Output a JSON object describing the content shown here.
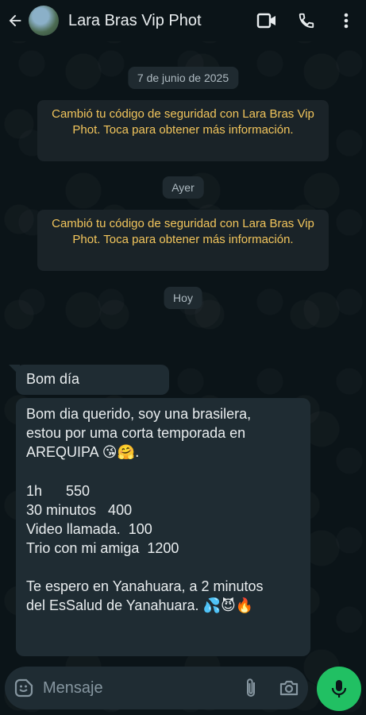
{
  "header": {
    "contact_name": "Lara Bras Vip Phot"
  },
  "chat": {
    "date_1": "7 de junio de 2025",
    "security_notice_1": "Cambió tu código de seguridad con Lara Bras Vip Phot. Toca para obtener más información.",
    "date_2": "Ayer",
    "security_notice_2": "Cambió tu código de seguridad con Lara Bras Vip Phot. Toca para obtener más información.",
    "date_3": "Hoy",
    "message_1": "Bom día",
    "message_2": {
      "line_1": "Bom dia querido, soy una brasilera,",
      "line_2": "estou por uma corta temporada en",
      "line_3": "AREQUIPA",
      "line_3_emojis": "😘🤗.",
      "price_1": "1h      550",
      "price_2": "30 minutos   400",
      "price_3": "Video llamada.  100",
      "price_4": "Trio con mi amiga  1200",
      "line_8": "Te espero en Yanahuara, a 2 minutos",
      "line_9": "del EsSalud de Yanahuara.",
      "line_9_emojis": "💦😈🔥"
    }
  },
  "input": {
    "placeholder": "Mensaje"
  },
  "icons": {
    "back": "arrow-left-icon",
    "video": "video-call-icon",
    "call": "phone-icon",
    "menu": "more-vertical-icon",
    "emoji": "emoji-icon",
    "attach": "paperclip-icon",
    "camera": "camera-icon",
    "mic": "mic-icon"
  },
  "colors": {
    "accent": "#21c063",
    "notice_text": "#f2c55c",
    "bubble": "#1f2c33"
  }
}
